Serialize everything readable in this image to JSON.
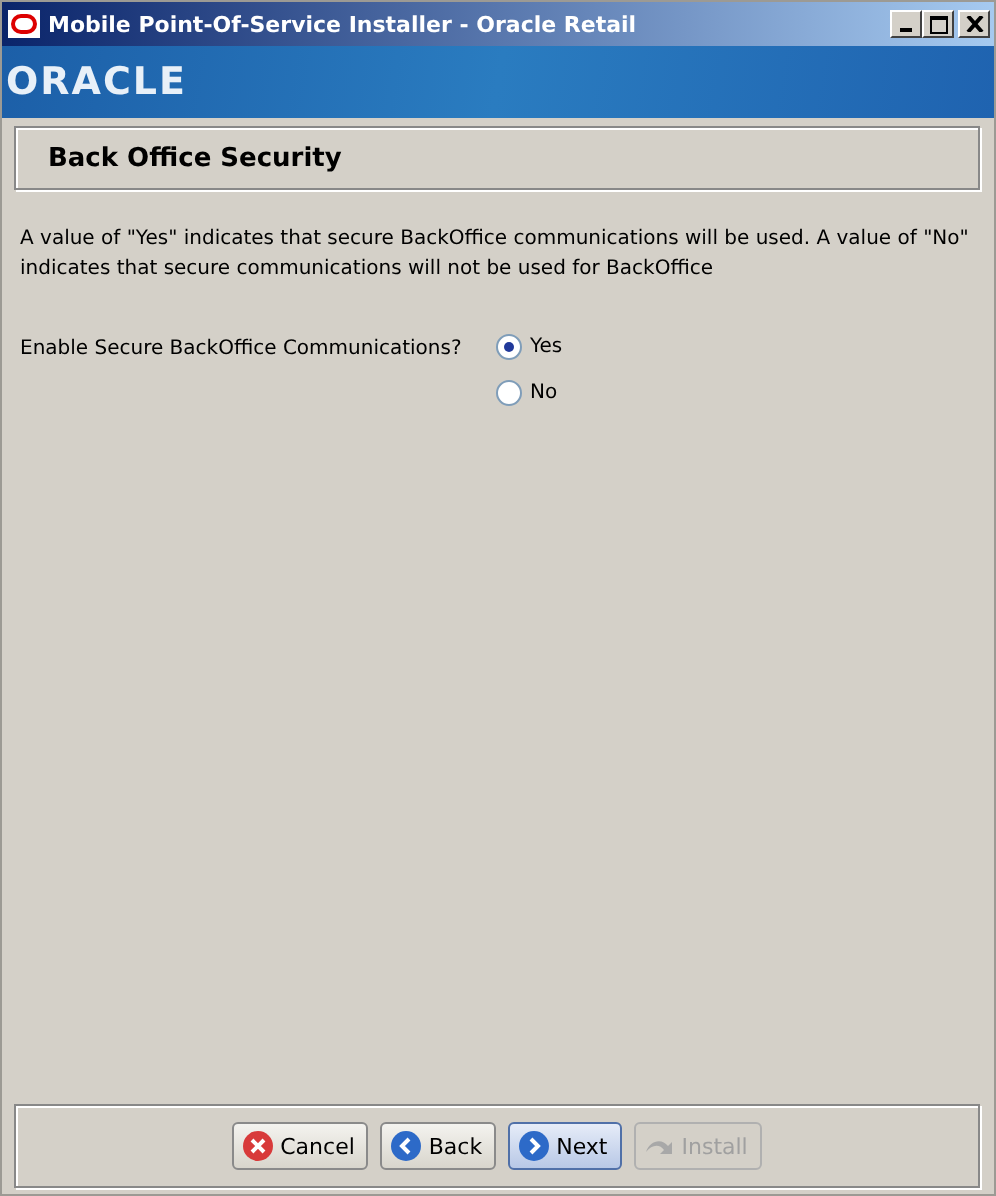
{
  "window": {
    "title": "Mobile Point-Of-Service Installer - Oracle Retail"
  },
  "banner": {
    "logo": "ORACLE"
  },
  "header": {
    "title": "Back Office Security"
  },
  "description": "A value of \"Yes\" indicates that secure BackOffice communications will be used.  A value of \"No\" indicates that secure communications will not be used for BackOffice",
  "question": {
    "label": "Enable Secure BackOffice Communications?",
    "options": [
      {
        "label": "Yes",
        "selected": true
      },
      {
        "label": "No",
        "selected": false
      }
    ]
  },
  "buttons": [
    {
      "label": "Cancel",
      "kind": "cancel",
      "disabled": false,
      "focused": false
    },
    {
      "label": "Back",
      "kind": "back",
      "disabled": false,
      "focused": false
    },
    {
      "label": "Next",
      "kind": "next",
      "disabled": false,
      "focused": true
    },
    {
      "label": "Install",
      "kind": "install",
      "disabled": true,
      "focused": false
    }
  ]
}
